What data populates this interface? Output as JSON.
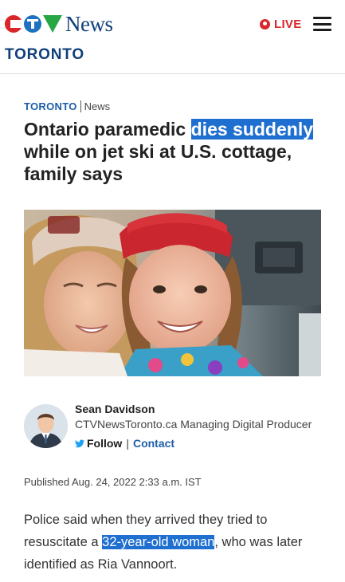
{
  "header": {
    "brand": "News",
    "live_label": "LIVE",
    "region": "TORONTO"
  },
  "article": {
    "section": "TORONTO",
    "subsection": "News",
    "headline": {
      "before": "Ontario paramedic ",
      "highlight": "dies suddenly",
      "after": " while on jet ski at U.S. cottage, family says"
    },
    "author": {
      "name": "Sean Davidson",
      "role": "CTVNewsToronto.ca Managing Digital Producer",
      "follow_label": "Follow",
      "separator": "|",
      "contact_label": "Contact"
    },
    "published": "Published Aug. 24, 2022 2:33 a.m. IST",
    "body": {
      "before": "Police said when they arrived they tried to resuscitate a ",
      "highlight": "32-year-old woman",
      "after": ", who was later identified as Ria Vannoort."
    }
  },
  "icons": [
    "ctv-logo-icon",
    "live-dot-icon",
    "hamburger-menu-icon",
    "twitter-bird-icon"
  ],
  "colors": {
    "brand_red": "#d9262b",
    "brand_blue": "#0f3f7a",
    "link_blue": "#1e5ea8",
    "highlight": "#1f6fd0"
  }
}
